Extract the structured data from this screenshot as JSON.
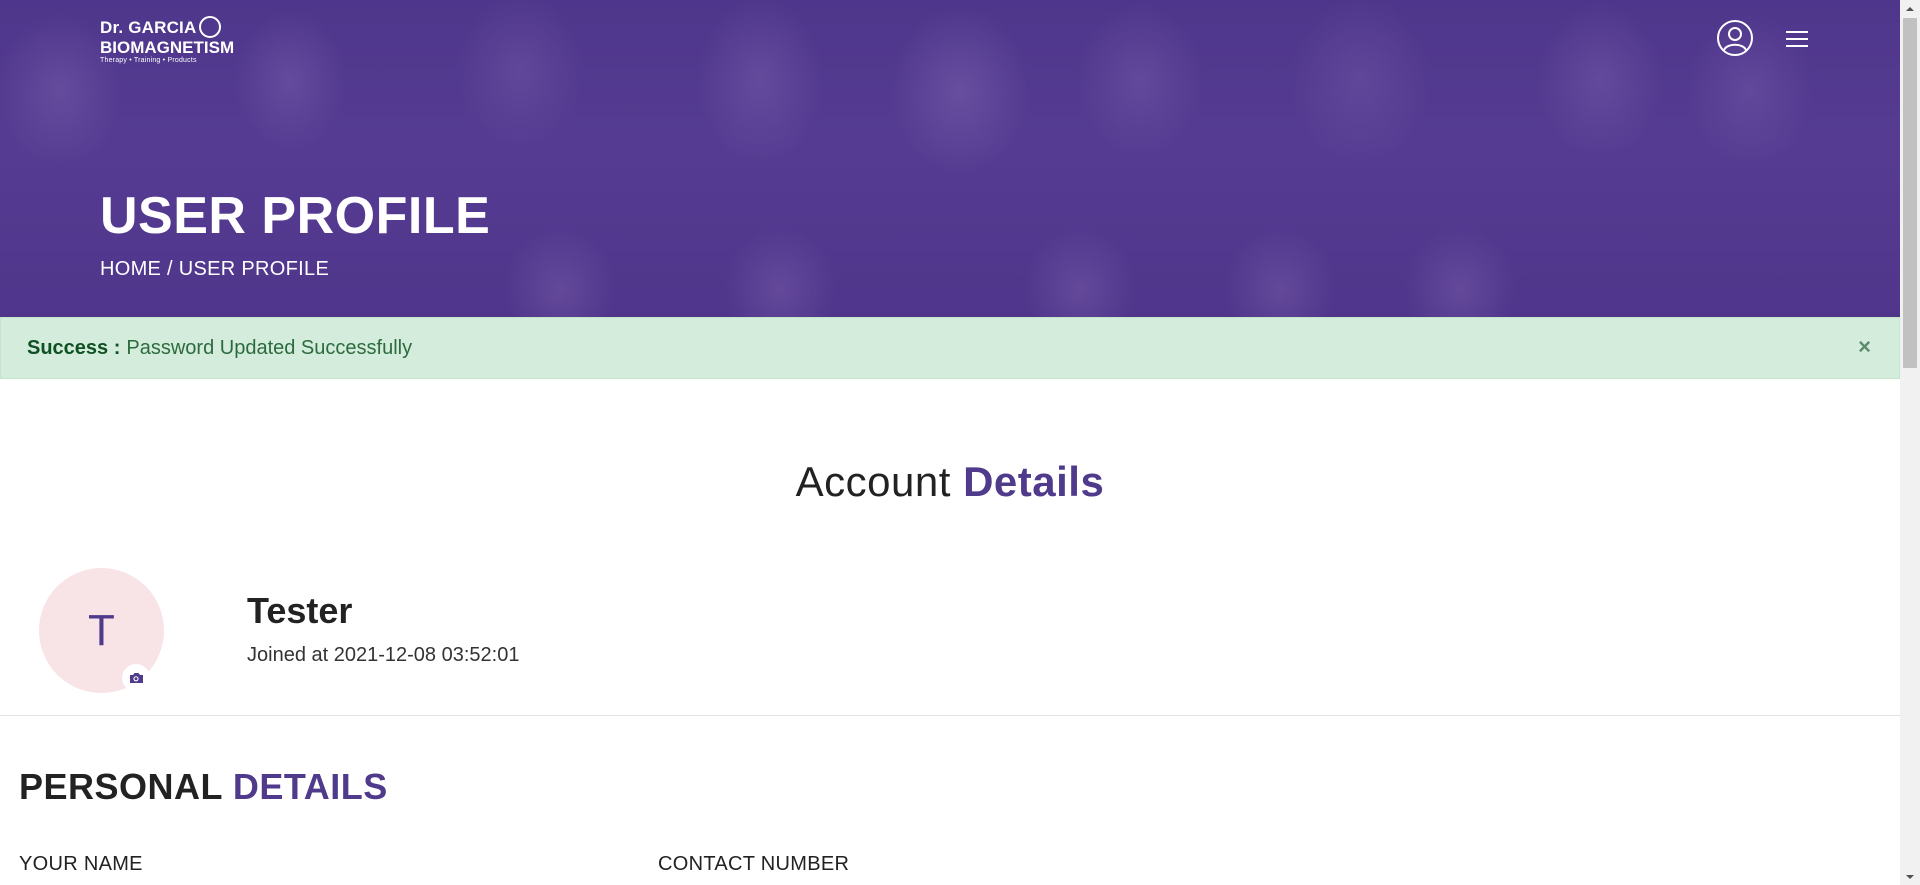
{
  "header": {
    "logo_line1": "Dr. GARCIA",
    "logo_line2": "BIOMAGNETISM",
    "logo_line3": "Therapy • Training • Products",
    "user_icon": "user-circle-icon",
    "menu_icon": "hamburger-menu-icon"
  },
  "hero": {
    "title": "USER PROFILE",
    "breadcrumb_home": "HOME",
    "breadcrumb_sep": " / ",
    "breadcrumb_current": "USER PROFILE"
  },
  "alert": {
    "label": "Success :",
    "message": "Password Updated Successfully",
    "close": "×"
  },
  "account": {
    "title_plain": "Account ",
    "title_accent": "Details",
    "avatar_initial": "T",
    "camera_icon": "camera-icon",
    "user_name": "Tester",
    "joined": "Joined at 2021-12-08 03:52:01"
  },
  "personal": {
    "title_plain": "PERSONAL ",
    "title_accent": "DETAILS",
    "field_name_label": "YOUR NAME",
    "field_contact_label": "CONTACT NUMBER"
  },
  "colors": {
    "brand": "#4f3a8c",
    "success_bg": "#d4ecdc",
    "avatar_bg": "#f8e3e6"
  }
}
